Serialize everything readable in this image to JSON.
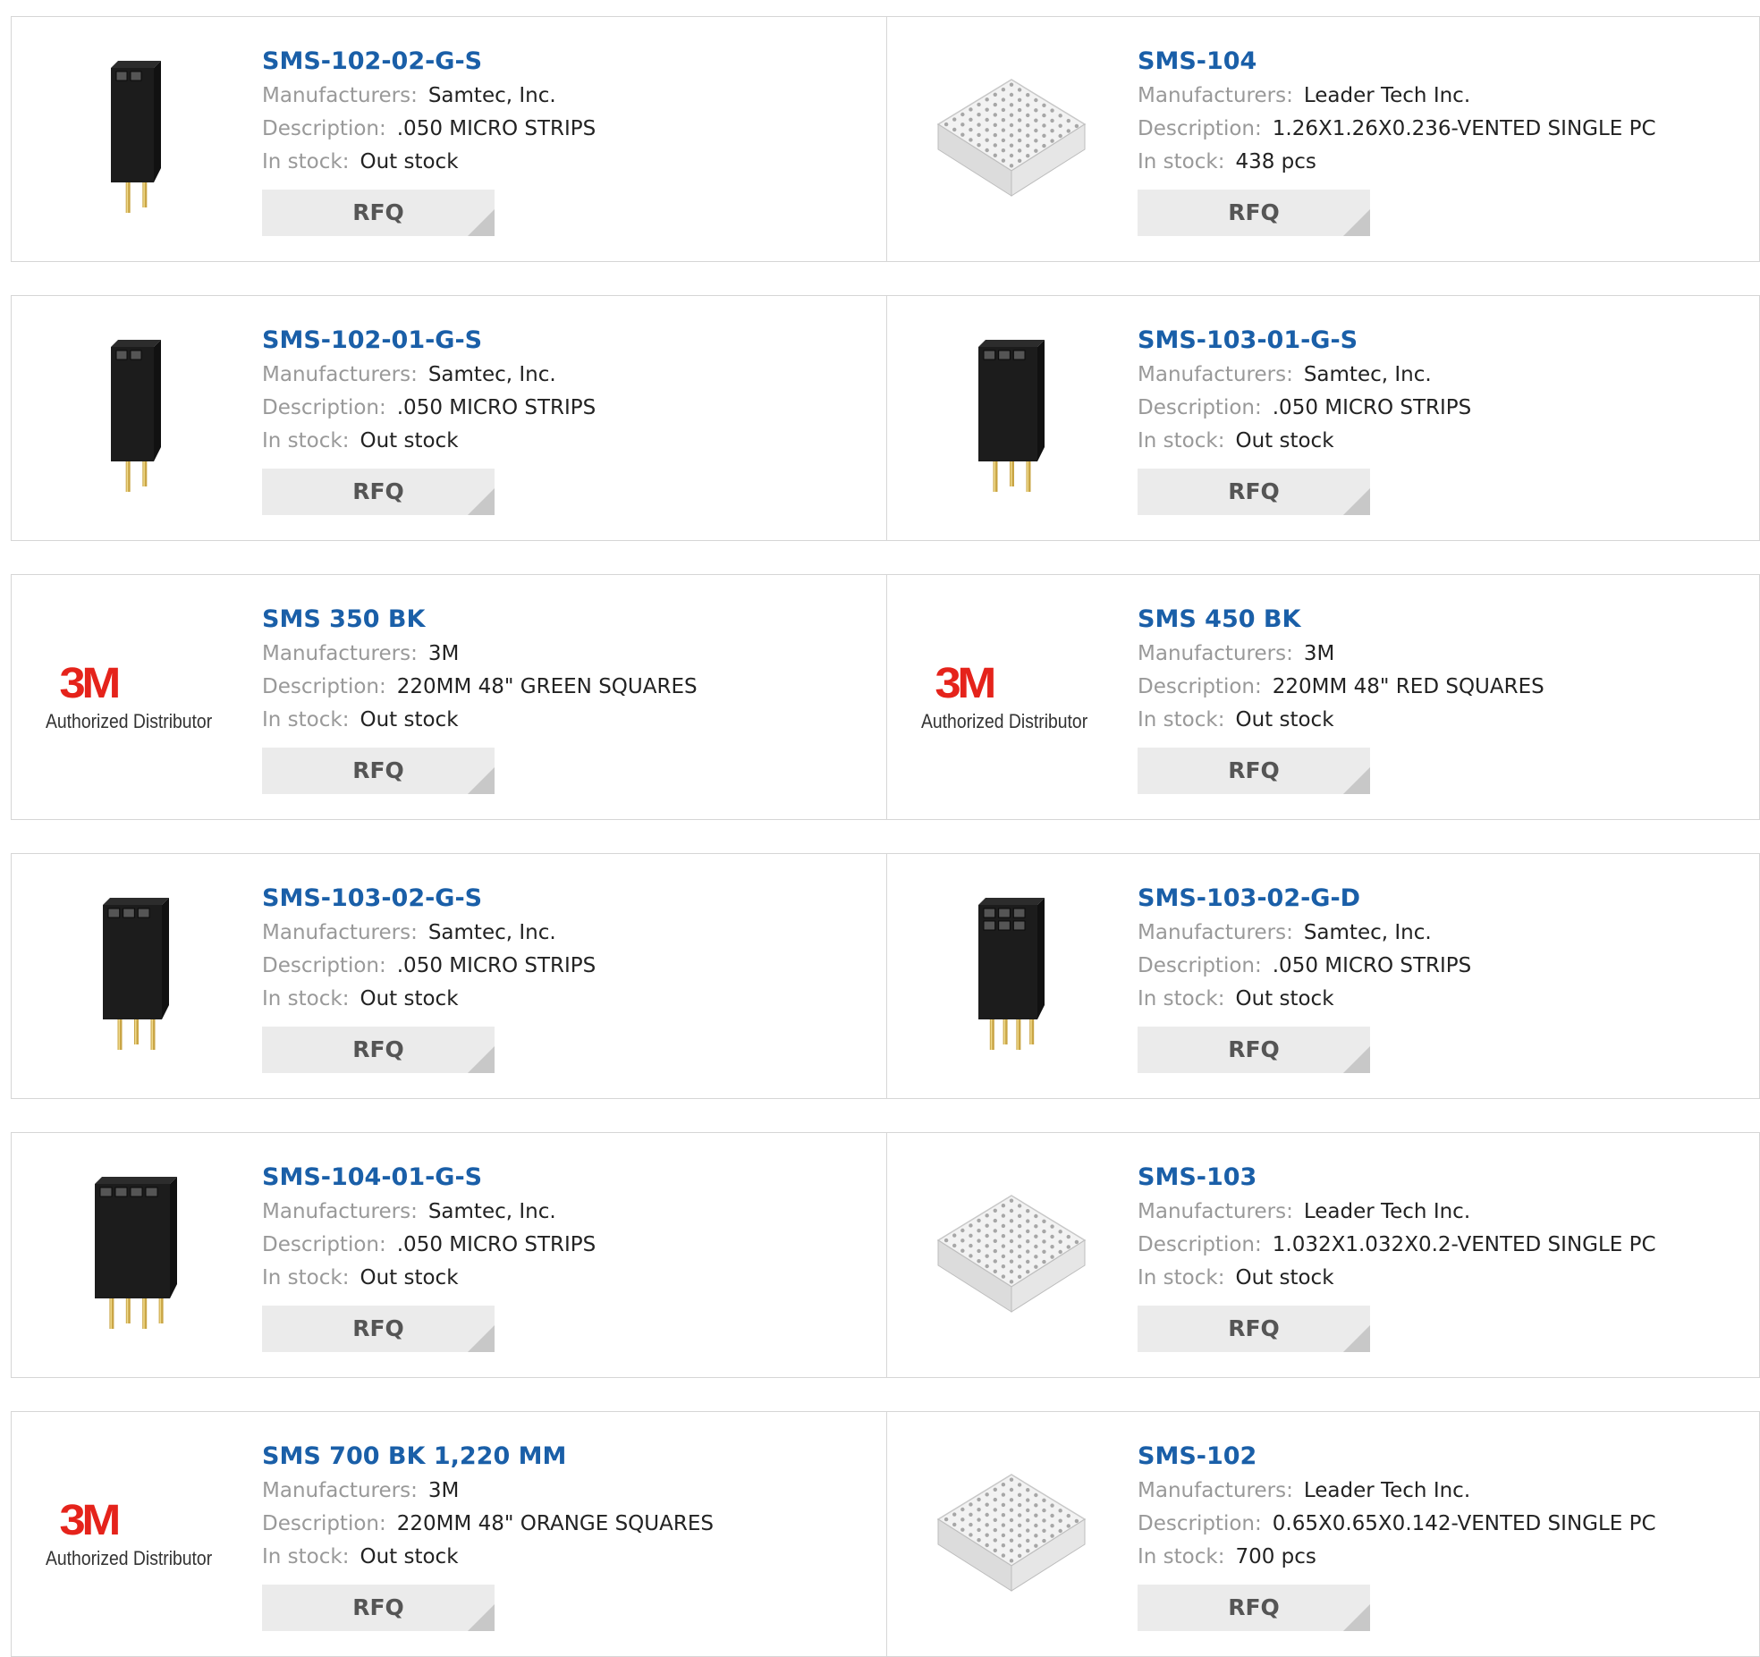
{
  "labels": {
    "manufacturers": "Manufacturers:",
    "description": "Description:",
    "stock": "In stock:",
    "rfq": "RFQ"
  },
  "brand_logo": {
    "mark": "3M",
    "subtitle": "Authorized Distributor"
  },
  "colors": {
    "title": "#1a5fa8",
    "logo_red": "#e5231b",
    "button_bg": "#ebebeb"
  },
  "products": [
    {
      "part": "SMS-102-02-G-S",
      "manufacturer": "Samtec, Inc.",
      "description": ".050 MICRO STRIPS",
      "stock": "Out stock",
      "image": "connector-2pin-icon"
    },
    {
      "part": "SMS-104",
      "manufacturer": "Leader Tech Inc.",
      "description": "1.26X1.26X0.236-VENTED SINGLE PC",
      "stock": "438 pcs",
      "image": "shield-can-icon"
    },
    {
      "part": "SMS-102-01-G-S",
      "manufacturer": "Samtec, Inc.",
      "description": ".050 MICRO STRIPS",
      "stock": "Out stock",
      "image": "connector-2pin-icon"
    },
    {
      "part": "SMS-103-01-G-S",
      "manufacturer": "Samtec, Inc.",
      "description": ".050 MICRO STRIPS",
      "stock": "Out stock",
      "image": "connector-3pin-icon"
    },
    {
      "part": "SMS 350 BK",
      "manufacturer": "3M",
      "description": "220MM 48\" GREEN SQUARES",
      "stock": "Out stock",
      "image": "3m-logo"
    },
    {
      "part": "SMS 450 BK",
      "manufacturer": "3M",
      "description": "220MM 48\" RED SQUARES",
      "stock": "Out stock",
      "image": "3m-logo"
    },
    {
      "part": "SMS-103-02-G-S",
      "manufacturer": "Samtec, Inc.",
      "description": ".050 MICRO STRIPS",
      "stock": "Out stock",
      "image": "connector-3pin-icon"
    },
    {
      "part": "SMS-103-02-G-D",
      "manufacturer": "Samtec, Inc.",
      "description": ".050 MICRO STRIPS",
      "stock": "Out stock",
      "image": "connector-dual-row-icon"
    },
    {
      "part": "SMS-104-01-G-S",
      "manufacturer": "Samtec, Inc.",
      "description": ".050 MICRO STRIPS",
      "stock": "Out stock",
      "image": "connector-4pin-icon"
    },
    {
      "part": "SMS-103",
      "manufacturer": "Leader Tech Inc.",
      "description": "1.032X1.032X0.2-VENTED SINGLE PC",
      "stock": "Out stock",
      "image": "shield-can-icon"
    },
    {
      "part": "SMS 700 BK 1,220 MM",
      "manufacturer": "3M",
      "description": "220MM 48\" ORANGE SQUARES",
      "stock": "Out stock",
      "image": "3m-logo"
    },
    {
      "part": "SMS-102",
      "manufacturer": "Leader Tech Inc.",
      "description": "0.65X0.65X0.142-VENTED SINGLE PC",
      "stock": "700 pcs",
      "image": "shield-can-icon"
    }
  ]
}
